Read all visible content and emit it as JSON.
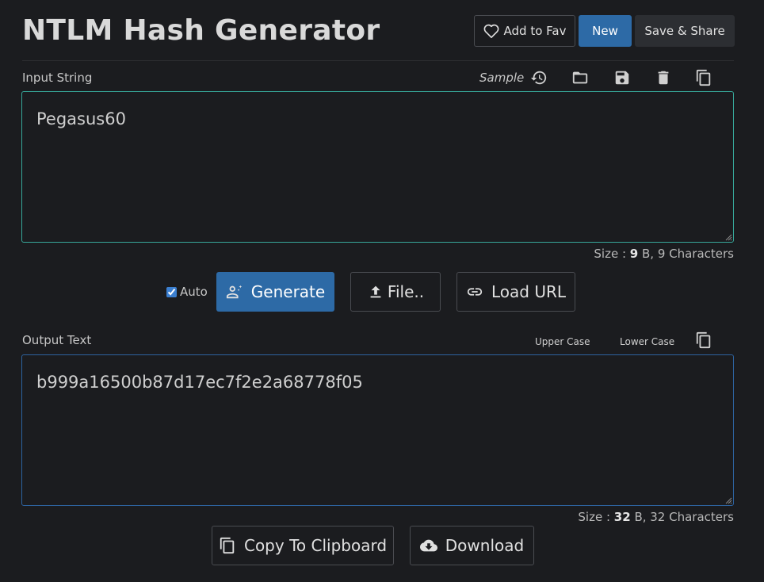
{
  "header": {
    "title": "NTLM Hash Generator",
    "fav_label": "Add to Fav",
    "new_label": "New",
    "save_label": "Save & Share"
  },
  "input": {
    "label": "Input String",
    "sample_label": "Sample",
    "value": "Pegasus60",
    "size_prefix": "Size : ",
    "size_bytes": "9",
    "size_suffix": " B, 9 Characters"
  },
  "actions": {
    "auto_label": "Auto",
    "auto_checked": true,
    "generate_label": "Generate",
    "file_label": "File..",
    "load_url_label": "Load URL"
  },
  "output": {
    "label": "Output Text",
    "upper_label": "Upper Case",
    "lower_label": "Lower Case",
    "value": "b999a16500b87d17ec7f2e2a68778f05",
    "size_prefix": "Size : ",
    "size_bytes": "32",
    "size_suffix": " B, 32 Characters",
    "copy_label": "Copy To Clipboard",
    "download_label": "Download"
  },
  "colors": {
    "background": "#1b1c1f",
    "accent": "#2d6aa6",
    "input_border": "#37a89a",
    "output_border": "#2d63a0"
  },
  "icons": [
    "heart-icon",
    "history-icon",
    "folder-icon",
    "save-icon",
    "trash-icon",
    "copy-icon",
    "generate-icon",
    "upload-icon",
    "link-icon",
    "download-icon"
  ]
}
